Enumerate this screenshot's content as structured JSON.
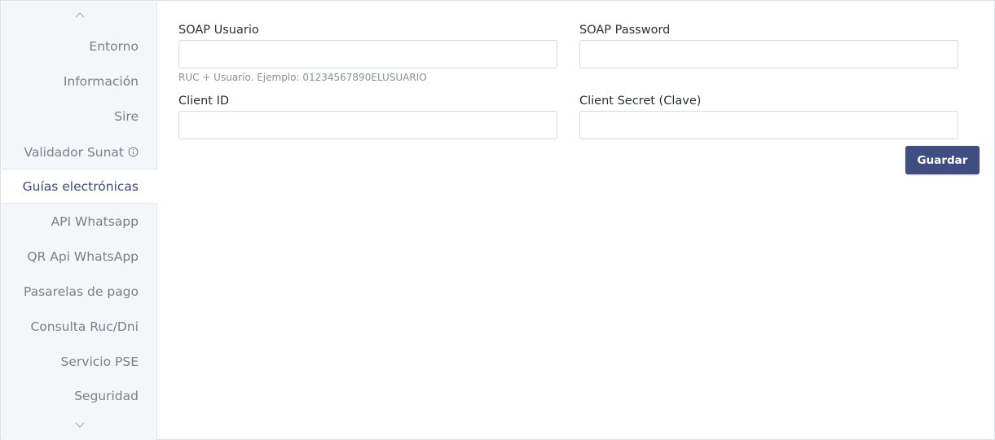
{
  "sidebar": {
    "items": [
      {
        "label": "Entorno",
        "active": false
      },
      {
        "label": "Información",
        "active": false
      },
      {
        "label": "Sire",
        "active": false
      },
      {
        "label": "Validador Sunat",
        "active": false,
        "icon": "info-icon"
      },
      {
        "label": "Guías electrónicas",
        "active": true
      },
      {
        "label": "API Whatsapp",
        "active": false
      },
      {
        "label": "QR Api WhatsApp",
        "active": false
      },
      {
        "label": "Pasarelas de pago",
        "active": false
      },
      {
        "label": "Consulta Ruc/Dni",
        "active": false
      },
      {
        "label": "Servicio PSE",
        "active": false
      },
      {
        "label": "Seguridad",
        "active": false
      }
    ],
    "scroll_up_icon": "chevron-up-icon",
    "scroll_down_icon": "chevron-down-icon"
  },
  "form": {
    "soap_user": {
      "label": "SOAP Usuario",
      "value": "",
      "placeholder": "",
      "help": "RUC + Usuario. Ejemplo: 01234567890ELUSUARIO"
    },
    "soap_password": {
      "label": "SOAP Password",
      "value": "",
      "placeholder": ""
    },
    "client_id": {
      "label": "Client ID",
      "value": "",
      "placeholder": ""
    },
    "client_secret": {
      "label": "Client Secret (Clave)",
      "value": "",
      "placeholder": ""
    },
    "save_label": "Guardar"
  },
  "colors": {
    "accent": "#3f4d80",
    "active_text": "#3d4a7a",
    "sidebar_bg": "#f4f6fa"
  }
}
